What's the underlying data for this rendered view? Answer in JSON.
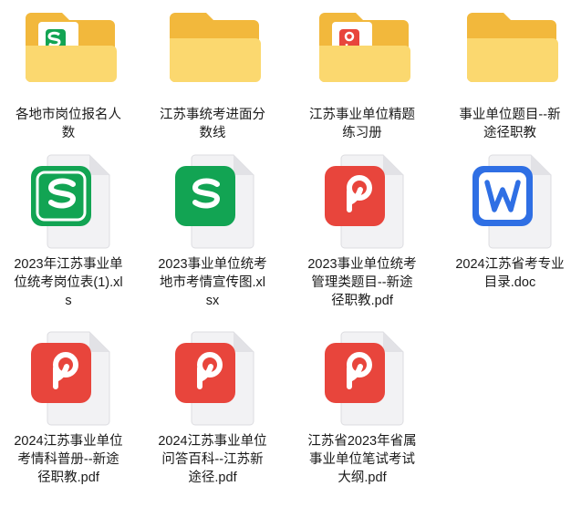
{
  "items": [
    {
      "label": "各地市岗位报名人数",
      "type": "folder",
      "badge": "sheet"
    },
    {
      "label": "江苏事统考进面分数线",
      "type": "folder",
      "badge": ""
    },
    {
      "label": "江苏事业单位精题练习册",
      "type": "folder",
      "badge": "pdf"
    },
    {
      "label": "事业单位题目--新途径职教",
      "type": "folder",
      "badge": ""
    },
    {
      "label": "2023年江苏事业单位统考岗位表(1).xls",
      "type": "xls"
    },
    {
      "label": "2023事业单位统考地市考情宣传图.xlsx",
      "type": "xls"
    },
    {
      "label": "2023事业单位统考管理类题目--新途径职教.pdf",
      "type": "pdf"
    },
    {
      "label": "2024江苏省考专业目录.doc",
      "type": "doc"
    },
    {
      "label": "2024江苏事业单位考情科普册--新途径职教.pdf",
      "type": "pdf"
    },
    {
      "label": "2024江苏事业单位问答百科--江苏新途径.pdf",
      "type": "pdf"
    },
    {
      "label": "江苏省2023年省属事业单位笔试考试大纲.pdf",
      "type": "pdf"
    }
  ],
  "colors": {
    "folder": "#f5c451",
    "folder_front": "#fbd86f",
    "xls": "#12a453",
    "pdf": "#e8453c",
    "doc": "#2f6fe4"
  }
}
